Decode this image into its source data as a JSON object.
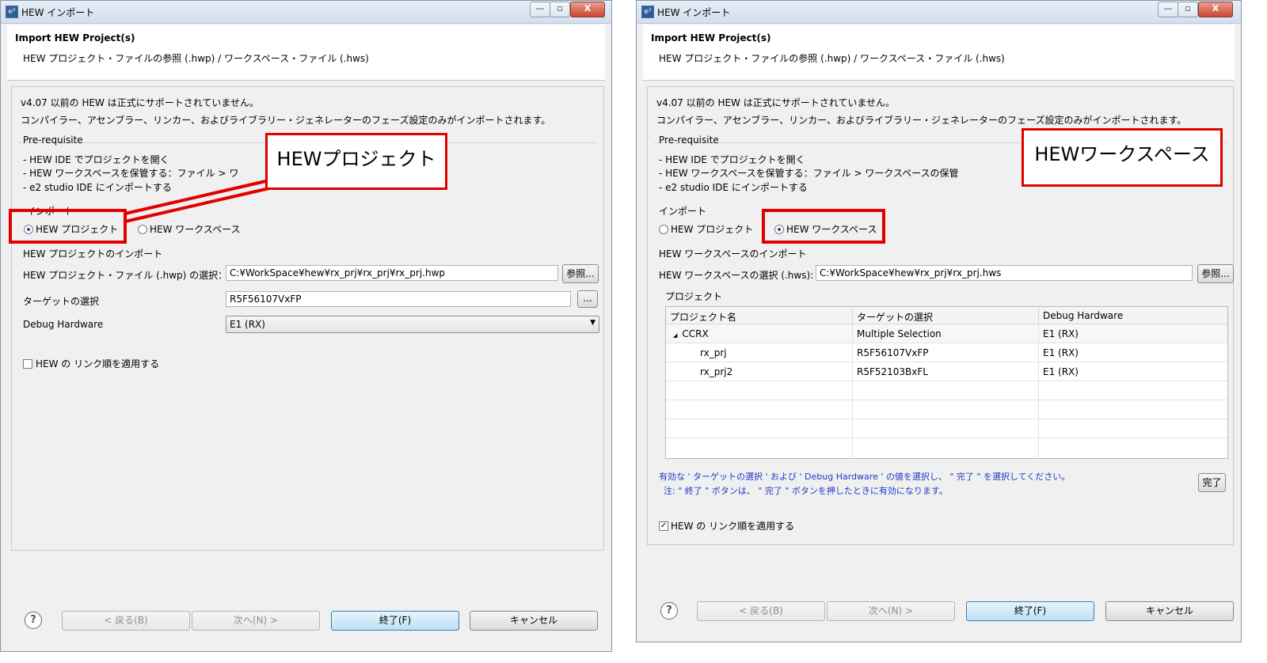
{
  "left_window": {
    "title": "HEW インポート",
    "header_title": "Import HEW Project(s)",
    "header_subtitle": "HEW プロジェクト・ファイルの参照 (.hwp) / ワークスペース・ファイル (.hws)",
    "info_line1": "v4.07 以前の HEW は正式にサポートされていません。",
    "info_line2": "コンパイラー、アセンブラー、リンカー、およびライブラリー・ジェネレーターのフェーズ設定のみがインポートされます。",
    "prereq_title": "Pre-requisite",
    "prereq_items": [
      "- HEW IDE でプロジェクトを開く",
      "- HEW ワークスペースを保管する：ファイル > ワ",
      "- e2 studio IDE にインポートする"
    ],
    "import_group": "インポート",
    "radio_project": "HEW プロジェクト",
    "radio_workspace": "HEW ワークスペース",
    "section_title": "HEW プロジェクトのインポート",
    "file_label": "HEW プロジェクト・ファイル (.hwp) の選択：",
    "file_value": "C:¥WorkSpace¥hew¥rx_prj¥rx_prj¥rx_prj.hwp",
    "browse_label": "参照...",
    "target_label": "ターゲットの選択",
    "target_value": "R5F56107VxFP",
    "target_btn": "...",
    "debug_label": "Debug Hardware",
    "debug_value": "E1 (RX)",
    "link_label": "HEW の リンク順を適用する",
    "callout": "HEWプロジェクト",
    "btn_back": "< 戻る(B)",
    "btn_next": "次へ(N) >",
    "btn_finish": "終了(F)",
    "btn_cancel": "キャンセル"
  },
  "right_window": {
    "title": "HEW インポート",
    "header_title": "Import HEW Project(s)",
    "header_subtitle": "HEW プロジェクト・ファイルの参照 (.hwp) / ワークスペース・ファイル (.hws)",
    "info_line1": "v4.07 以前の HEW は正式にサポートされていません。",
    "info_line2": "コンパイラー、アセンブラー、リンカー、およびライブラリー・ジェネレーターのフェーズ設定のみがインポートされます。",
    "prereq_title": "Pre-requisite",
    "prereq_items": [
      "- HEW IDE でプロジェクトを開く",
      "- HEW ワークスペースを保管する：ファイル > ワークスペースの保管",
      "- e2 studio IDE にインポートする"
    ],
    "import_group": "インポート",
    "radio_project": "HEW プロジェクト",
    "radio_workspace": "HEW ワークスペース",
    "section_title": "HEW ワークスペースのインポート",
    "file_label": "HEW ワークスペースの選択 (.hws):",
    "file_value": "C:¥WorkSpace¥hew¥rx_prj¥rx_prj.hws",
    "browse_label": "参照...",
    "project_group": "プロジェクト",
    "table_headers": [
      "プロジェクト名",
      "ターゲットの選択",
      "Debug Hardware"
    ],
    "table_rows": [
      [
        "CCRX",
        "Multiple Selection",
        "E1 (RX)"
      ],
      [
        "rx_prj",
        "R5F56107VxFP",
        "E1 (RX)"
      ],
      [
        "rx_prj2",
        "R5F52103BxFL",
        "E1 (RX)"
      ]
    ],
    "tree_toggle": "◢",
    "note_line1": "有効な ' ターゲットの選択 ' および ' Debug Hardware ' の値を選択し、 \" 完了 \" を選択してください。",
    "note_line2": "注: \" 終了 \" ボタンは、 \" 完了 \" ボタンを押したときに有効になります。",
    "done_btn": "完了",
    "link_label": "HEW の リンク順を適用する",
    "callout": "HEWワークスペース",
    "btn_back": "< 戻る(B)",
    "btn_next": "次へ(N) >",
    "btn_finish": "終了(F)",
    "btn_cancel": "キャンセル"
  },
  "window_buttons": {
    "minimize": "—",
    "maximize": "▫",
    "close": "X"
  },
  "help_icon": "?",
  "app_icon": "e²",
  "check_mark": "✓",
  "combo_arrow": "▼",
  "colors": {
    "highlight": "#e00000",
    "note_text": "#1f39c8"
  }
}
